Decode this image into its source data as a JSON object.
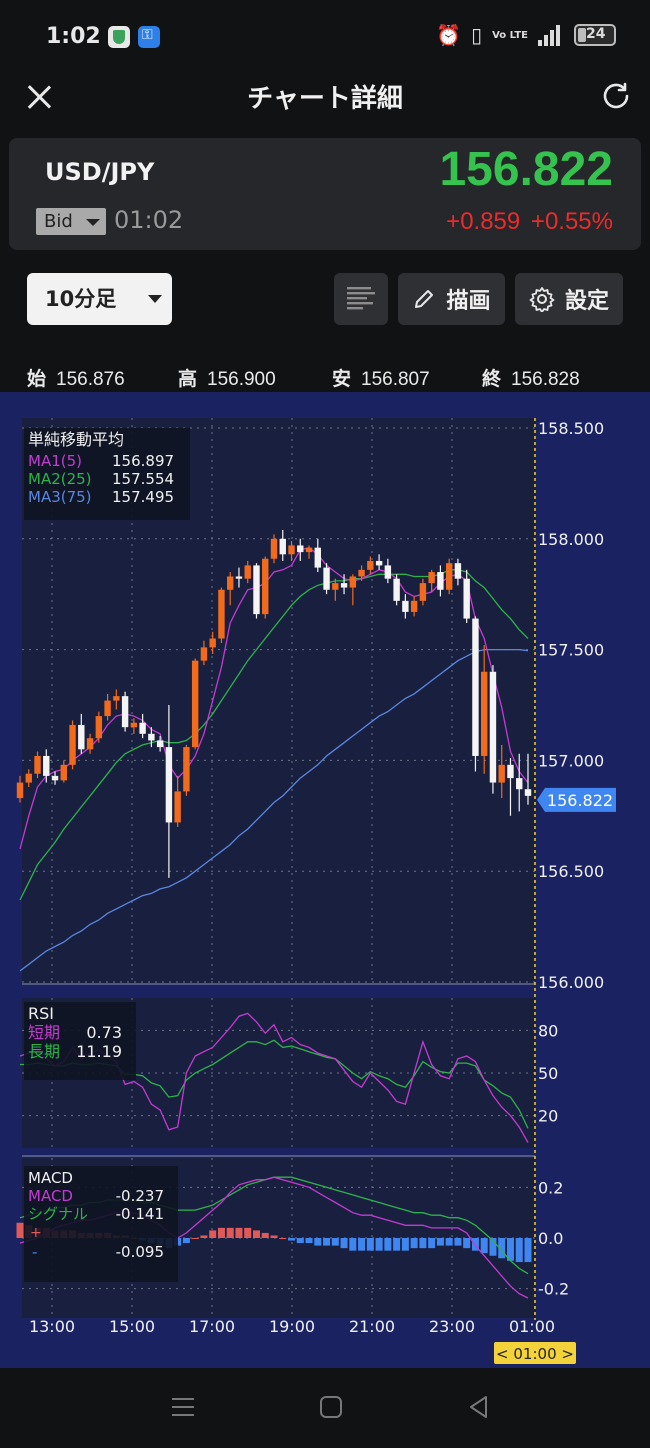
{
  "status_bar": {
    "time": "1:02",
    "battery": "24",
    "network": "Vo LTE"
  },
  "header": {
    "title": "チャート詳細"
  },
  "quote": {
    "pair": "USD/JPY",
    "side": "Bid",
    "time": "01:02",
    "price": "156.822",
    "change": "+0.859",
    "change_pct": "+0.55%"
  },
  "controls": {
    "timeframe": "10分足",
    "draw_label": "描画",
    "settings_label": "設定"
  },
  "ohlc": {
    "open_label": "始",
    "open": "156.876",
    "high_label": "高",
    "high": "156.900",
    "low_label": "安",
    "low": "156.807",
    "close_label": "終",
    "close": "156.828"
  },
  "legends": {
    "ma_title": "単純移動平均",
    "ma1_label": "MA1(5)",
    "ma1_value": "156.897",
    "ma2_label": "MA2(25)",
    "ma2_value": "157.554",
    "ma3_label": "MA3(75)",
    "ma3_value": "157.495",
    "rsi_title": "RSI",
    "rsi_short_label": "短期",
    "rsi_short_value": "0.73",
    "rsi_long_label": "長期",
    "rsi_long_value": "11.19",
    "macd_title": "MACD",
    "macd_label": "MACD",
    "macd_value": "-0.237",
    "signal_label": "シグナル",
    "signal_value": "-0.141",
    "hist_plus_label": "+",
    "hist_minus_label": "-",
    "hist_value": "-0.095"
  },
  "colors": {
    "up": "#f26a1b",
    "down": "#f4f4f4",
    "ma1": "#c33bd1",
    "ma2": "#2fb24a",
    "ma3": "#5a86e0",
    "rsi_short": "#c33bd1",
    "rsi_long": "#2fb24a",
    "hist_pos": "#e05a5a",
    "hist_neg": "#3f86f0",
    "price_up": "#35c24e",
    "change_down": "#ee2a2a",
    "last_price_tag": "#3f86f0",
    "crosshair": "#f3d23a"
  },
  "chart_data": {
    "type": "candlestick",
    "price_axis": {
      "ticks": [
        "158.500",
        "158.000",
        "157.500",
        "157.000",
        "156.500",
        "156.000"
      ],
      "range": [
        156.0,
        158.5
      ]
    },
    "rsi_axis": {
      "ticks": [
        "80",
        "50",
        "20"
      ],
      "range": [
        0,
        100
      ]
    },
    "macd_axis": {
      "ticks": [
        "0.2",
        "0.0",
        "-0.2"
      ],
      "range": [
        -0.3,
        0.3
      ]
    },
    "x_ticks": [
      "13:00",
      "15:00",
      "17:00",
      "19:00",
      "21:00",
      "23:00",
      "01:00"
    ],
    "last_price": "156.822",
    "crosshair_time": "< 01:00 >",
    "candles": [
      [
        156.83,
        156.93,
        156.81,
        156.9
      ],
      [
        156.9,
        156.96,
        156.88,
        156.94
      ],
      [
        156.94,
        157.04,
        156.92,
        157.02
      ],
      [
        157.02,
        157.05,
        156.9,
        156.93
      ],
      [
        156.93,
        156.95,
        156.89,
        156.91
      ],
      [
        156.91,
        157.0,
        156.9,
        156.98
      ],
      [
        156.98,
        157.18,
        156.96,
        157.16
      ],
      [
        157.16,
        157.21,
        157.03,
        157.05
      ],
      [
        157.05,
        157.12,
        157.03,
        157.1
      ],
      [
        157.1,
        157.22,
        157.08,
        157.2
      ],
      [
        157.2,
        157.3,
        157.18,
        157.27
      ],
      [
        157.27,
        157.32,
        157.23,
        157.29
      ],
      [
        157.29,
        157.31,
        157.13,
        157.15
      ],
      [
        157.15,
        157.19,
        157.12,
        157.17
      ],
      [
        157.17,
        157.21,
        157.1,
        157.12
      ],
      [
        157.12,
        157.15,
        157.06,
        157.09
      ],
      [
        157.09,
        157.11,
        157.04,
        157.06
      ],
      [
        157.06,
        157.25,
        156.47,
        156.72
      ],
      [
        156.72,
        156.93,
        156.7,
        156.86
      ],
      [
        156.86,
        157.07,
        156.84,
        157.06
      ],
      [
        157.06,
        157.46,
        157.05,
        157.45
      ],
      [
        157.45,
        157.54,
        157.43,
        157.51
      ],
      [
        157.51,
        157.58,
        157.48,
        157.55
      ],
      [
        157.55,
        157.78,
        157.53,
        157.77
      ],
      [
        157.77,
        157.85,
        157.7,
        157.83
      ],
      [
        157.83,
        157.87,
        157.78,
        157.82
      ],
      [
        157.82,
        157.9,
        157.8,
        157.88
      ],
      [
        157.88,
        157.89,
        157.64,
        157.66
      ],
      [
        157.66,
        157.92,
        157.64,
        157.91
      ],
      [
        157.91,
        158.02,
        157.89,
        158.0
      ],
      [
        158.0,
        158.04,
        157.9,
        157.93
      ],
      [
        157.93,
        157.99,
        157.9,
        157.97
      ],
      [
        157.97,
        158.0,
        157.9,
        157.94
      ],
      [
        157.94,
        157.97,
        157.91,
        157.96
      ],
      [
        157.96,
        158.0,
        157.85,
        157.87
      ],
      [
        157.87,
        157.89,
        157.75,
        157.77
      ],
      [
        157.77,
        157.82,
        157.72,
        157.8
      ],
      [
        157.8,
        157.84,
        157.75,
        157.78
      ],
      [
        157.78,
        157.84,
        157.7,
        157.83
      ],
      [
        157.83,
        157.88,
        157.81,
        157.86
      ],
      [
        157.86,
        157.92,
        157.84,
        157.9
      ],
      [
        157.9,
        157.93,
        157.86,
        157.88
      ],
      [
        157.88,
        157.91,
        157.8,
        157.82
      ],
      [
        157.82,
        157.84,
        157.7,
        157.72
      ],
      [
        157.72,
        157.75,
        157.64,
        157.67
      ],
      [
        157.67,
        157.74,
        157.65,
        157.72
      ],
      [
        157.72,
        157.82,
        157.7,
        157.8
      ],
      [
        157.8,
        157.86,
        157.76,
        157.85
      ],
      [
        157.85,
        157.88,
        157.74,
        157.77
      ],
      [
        157.77,
        157.91,
        157.75,
        157.89
      ],
      [
        157.89,
        157.91,
        157.79,
        157.82
      ],
      [
        157.82,
        157.86,
        157.62,
        157.64
      ],
      [
        157.64,
        157.65,
        156.95,
        157.02
      ],
      [
        157.02,
        157.52,
        156.94,
        157.4
      ],
      [
        157.4,
        157.43,
        156.85,
        156.9
      ],
      [
        156.9,
        157.07,
        156.83,
        156.98
      ],
      [
        156.98,
        157.01,
        156.75,
        156.92
      ],
      [
        156.92,
        157.03,
        156.77,
        156.87
      ],
      [
        156.87,
        157.03,
        156.8,
        156.84
      ]
    ],
    "ma1": [
      156.6,
      156.75,
      156.88,
      156.93,
      156.95,
      156.96,
      157.0,
      157.03,
      157.06,
      157.1,
      157.16,
      157.2,
      157.21,
      157.2,
      157.18,
      157.14,
      157.12,
      156.98,
      156.92,
      156.96,
      157.02,
      157.12,
      157.27,
      157.42,
      157.62,
      157.7,
      157.77,
      157.78,
      157.8,
      157.85,
      157.86,
      157.88,
      157.95,
      157.96,
      157.93,
      157.88,
      157.85,
      157.82,
      157.81,
      157.82,
      157.84,
      157.86,
      157.85,
      157.82,
      157.76,
      157.74,
      157.75,
      157.76,
      157.8,
      157.83,
      157.84,
      157.81,
      157.64,
      157.55,
      157.39,
      157.24,
      157.04,
      156.95,
      156.9
    ],
    "ma2": [
      156.37,
      156.45,
      156.53,
      156.58,
      156.63,
      156.69,
      156.74,
      156.79,
      156.84,
      156.89,
      156.94,
      156.99,
      157.03,
      157.05,
      157.07,
      157.08,
      157.09,
      157.08,
      157.08,
      157.09,
      157.12,
      157.16,
      157.21,
      157.27,
      157.33,
      157.39,
      157.45,
      157.5,
      157.55,
      157.6,
      157.65,
      157.7,
      157.74,
      157.77,
      157.79,
      157.8,
      157.81,
      157.81,
      157.82,
      157.82,
      157.83,
      157.84,
      157.84,
      157.84,
      157.84,
      157.83,
      157.83,
      157.83,
      157.84,
      157.86,
      157.86,
      157.85,
      157.81,
      157.78,
      157.73,
      157.68,
      157.64,
      157.59,
      157.55
    ],
    "ma3": [
      156.05,
      156.08,
      156.11,
      156.14,
      156.16,
      156.18,
      156.21,
      156.23,
      156.26,
      156.28,
      156.31,
      156.33,
      156.35,
      156.37,
      156.39,
      156.4,
      156.42,
      156.43,
      156.45,
      156.47,
      156.5,
      156.53,
      156.56,
      156.59,
      156.62,
      156.66,
      156.69,
      156.73,
      156.77,
      156.81,
      156.84,
      156.88,
      156.92,
      156.95,
      156.98,
      157.02,
      157.05,
      157.08,
      157.11,
      157.14,
      157.17,
      157.2,
      157.22,
      157.25,
      157.28,
      157.3,
      157.33,
      157.36,
      157.39,
      157.42,
      157.45,
      157.47,
      157.49,
      157.5,
      157.5,
      157.5,
      157.5,
      157.5,
      157.495
    ],
    "rsi_short": [
      62,
      64,
      66,
      60,
      55,
      58,
      68,
      60,
      64,
      66,
      62,
      58,
      42,
      44,
      40,
      28,
      24,
      10,
      12,
      50,
      62,
      65,
      68,
      75,
      82,
      90,
      92,
      86,
      78,
      84,
      72,
      75,
      70,
      68,
      64,
      62,
      60,
      52,
      44,
      40,
      50,
      44,
      38,
      30,
      28,
      50,
      72,
      56,
      48,
      46,
      60,
      62,
      58,
      45,
      34,
      26,
      20,
      12,
      1
    ],
    "rsi_long": [
      56,
      56,
      57,
      56,
      55,
      55,
      57,
      56,
      56,
      57,
      56,
      55,
      49,
      49,
      48,
      43,
      41,
      33,
      34,
      45,
      50,
      53,
      56,
      60,
      64,
      68,
      72,
      72,
      70,
      73,
      68,
      69,
      67,
      65,
      63,
      61,
      60,
      55,
      50,
      46,
      51,
      48,
      46,
      42,
      40,
      48,
      58,
      54,
      51,
      50,
      57,
      57,
      55,
      45,
      41,
      36,
      33,
      24,
      11
    ],
    "macd": [
      -0.02,
      -0.01,
      0.0,
      0.02,
      0.04,
      0.05,
      0.06,
      0.07,
      0.07,
      0.08,
      0.09,
      0.1,
      0.1,
      0.1,
      0.09,
      0.07,
      0.05,
      0.02,
      0.0,
      0.02,
      0.05,
      0.08,
      0.11,
      0.14,
      0.18,
      0.21,
      0.22,
      0.23,
      0.23,
      0.24,
      0.23,
      0.22,
      0.21,
      0.2,
      0.18,
      0.16,
      0.14,
      0.12,
      0.1,
      0.09,
      0.09,
      0.08,
      0.07,
      0.06,
      0.05,
      0.05,
      0.05,
      0.04,
      0.04,
      0.04,
      0.04,
      0.02,
      -0.03,
      -0.07,
      -0.11,
      -0.15,
      -0.19,
      -0.22,
      -0.237
    ],
    "signal": [
      0.08,
      0.09,
      0.1,
      0.11,
      0.12,
      0.12,
      0.13,
      0.13,
      0.14,
      0.14,
      0.15,
      0.15,
      0.15,
      0.15,
      0.14,
      0.14,
      0.13,
      0.12,
      0.11,
      0.11,
      0.11,
      0.12,
      0.13,
      0.15,
      0.17,
      0.19,
      0.21,
      0.22,
      0.23,
      0.24,
      0.24,
      0.24,
      0.23,
      0.22,
      0.21,
      0.2,
      0.19,
      0.18,
      0.17,
      0.16,
      0.15,
      0.14,
      0.13,
      0.12,
      0.11,
      0.1,
      0.1,
      0.09,
      0.09,
      0.08,
      0.08,
      0.07,
      0.05,
      0.02,
      -0.01,
      -0.05,
      -0.09,
      -0.12,
      -0.141
    ],
    "histogram": [
      0.06,
      0.05,
      0.04,
      0.04,
      0.03,
      0.03,
      0.03,
      0.02,
      0.02,
      0.02,
      0.02,
      0.01,
      0.01,
      0.0,
      -0.01,
      -0.02,
      -0.03,
      -0.04,
      -0.03,
      -0.02,
      0.0,
      0.01,
      0.03,
      0.04,
      0.04,
      0.04,
      0.04,
      0.03,
      0.02,
      0.01,
      0.0,
      -0.01,
      -0.02,
      -0.02,
      -0.03,
      -0.03,
      -0.03,
      -0.04,
      -0.05,
      -0.05,
      -0.05,
      -0.05,
      -0.05,
      -0.05,
      -0.05,
      -0.04,
      -0.04,
      -0.04,
      -0.03,
      -0.03,
      -0.03,
      -0.04,
      -0.05,
      -0.06,
      -0.07,
      -0.08,
      -0.09,
      -0.095,
      -0.095
    ]
  }
}
